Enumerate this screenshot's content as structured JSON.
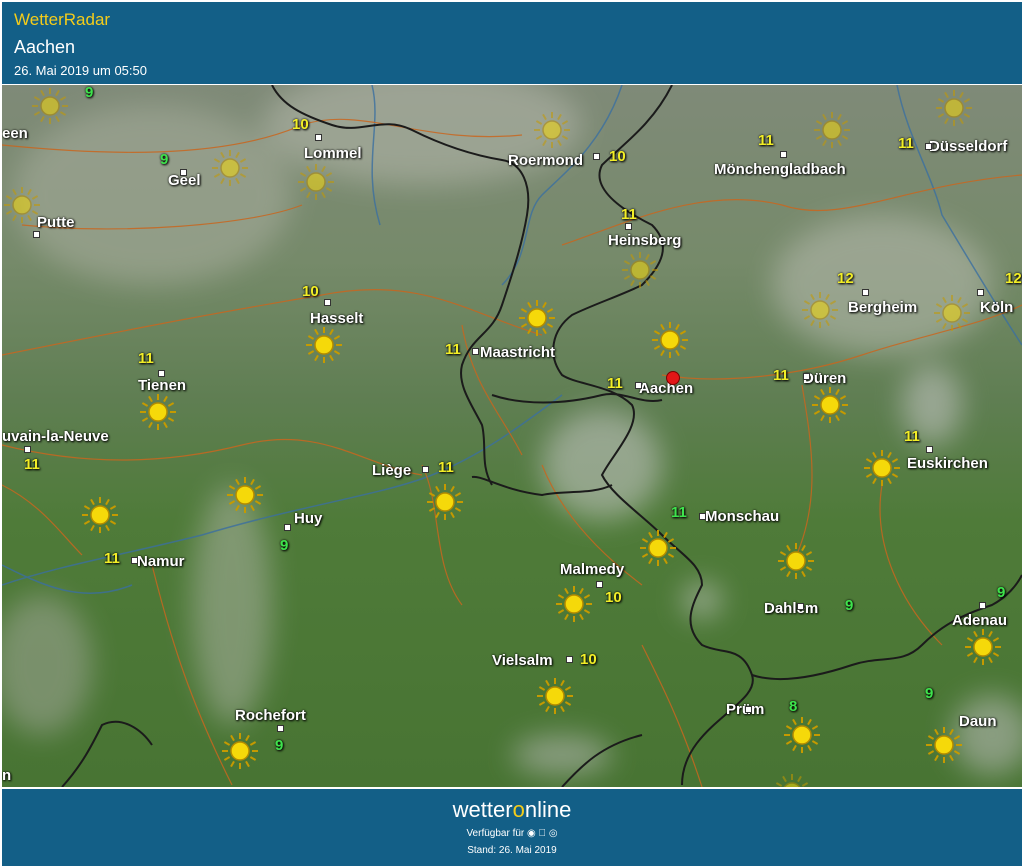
{
  "header": {
    "app_name": "WetterRadar",
    "location": "Aachen",
    "timestamp": "26. Mai 2019 um 05:50"
  },
  "map": {
    "cities": [
      {
        "name": "Lommel"
      },
      {
        "name": "Geel"
      },
      {
        "name": "Putte"
      },
      {
        "name": "Roermond"
      },
      {
        "name": "Mönchengladbach"
      },
      {
        "name": "Düsseldorf"
      },
      {
        "name": "Heinsberg"
      },
      {
        "name": "Hasselt"
      },
      {
        "name": "Maastricht"
      },
      {
        "name": "Bergheim"
      },
      {
        "name": "Köln"
      },
      {
        "name": "Tienen"
      },
      {
        "name": "Aachen"
      },
      {
        "name": "Düren"
      },
      {
        "name": "uvain-la-Neuve"
      },
      {
        "name": "Liège"
      },
      {
        "name": "Euskirchen"
      },
      {
        "name": "Huy"
      },
      {
        "name": "Monschau"
      },
      {
        "name": "Namur"
      },
      {
        "name": "Malmedy"
      },
      {
        "name": "Dahlem"
      },
      {
        "name": "Adenau"
      },
      {
        "name": "Vielsalm"
      },
      {
        "name": "Rochefort"
      },
      {
        "name": "Prüm"
      },
      {
        "name": "Daun"
      },
      {
        "name": "een"
      },
      {
        "name": "n"
      }
    ],
    "temperatures": [
      "9",
      "10",
      "9",
      "10",
      "11",
      "11",
      "11",
      "12",
      "12",
      "10",
      "11",
      "11",
      "11",
      "11",
      "11",
      "11",
      "11",
      "9",
      "11",
      "11",
      "10",
      "9",
      "9",
      "10",
      "9",
      "8",
      "9"
    ],
    "marker_icon": "location-pin-icon",
    "weather_icon": "sun-icon"
  },
  "footer": {
    "brand_prefix": "wetter",
    "brand_o": "o",
    "brand_suffix": "nline",
    "available_label": "Verfügbar für",
    "platform_icons": "android-icon apple-icon web-icon",
    "stand": "Stand: 26. Mai 2019"
  },
  "colors": {
    "header_bg": "#135f87",
    "app_name": "#f4cc1a",
    "temp_warm": "#f2ee27",
    "temp_cool": "#3ee34c",
    "marker": "#e21616"
  }
}
